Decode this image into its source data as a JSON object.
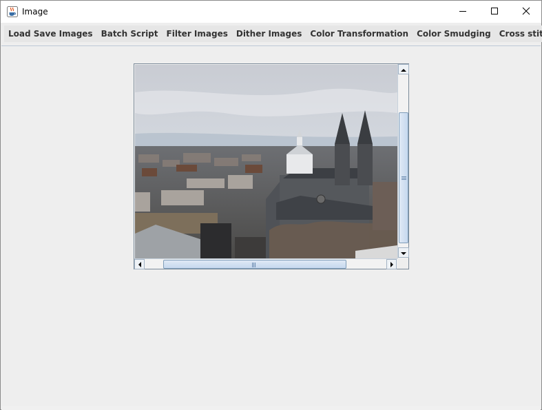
{
  "window": {
    "title": "Image",
    "icon": "java-cup-icon"
  },
  "controls": {
    "minimize_icon": "minimize-icon",
    "maximize_icon": "maximize-icon",
    "close_icon": "close-icon"
  },
  "menubar": {
    "items": [
      {
        "label": "Load Save Images"
      },
      {
        "label": "Batch Script"
      },
      {
        "label": "Filter Images"
      },
      {
        "label": "Dither Images"
      },
      {
        "label": "Color Transformation"
      },
      {
        "label": "Color Smudging"
      },
      {
        "label": "Cross stitch"
      }
    ]
  },
  "image_view": {
    "content": "city-skyline-with-cathedral-photo",
    "vertical_scroll_fraction": 0.35,
    "horizontal_scroll_fraction": 0.12
  },
  "colors": {
    "window_bg": "#eeeeee",
    "scroll_thumb": "#c6d8ee",
    "scroll_border": "#7f9db9"
  }
}
